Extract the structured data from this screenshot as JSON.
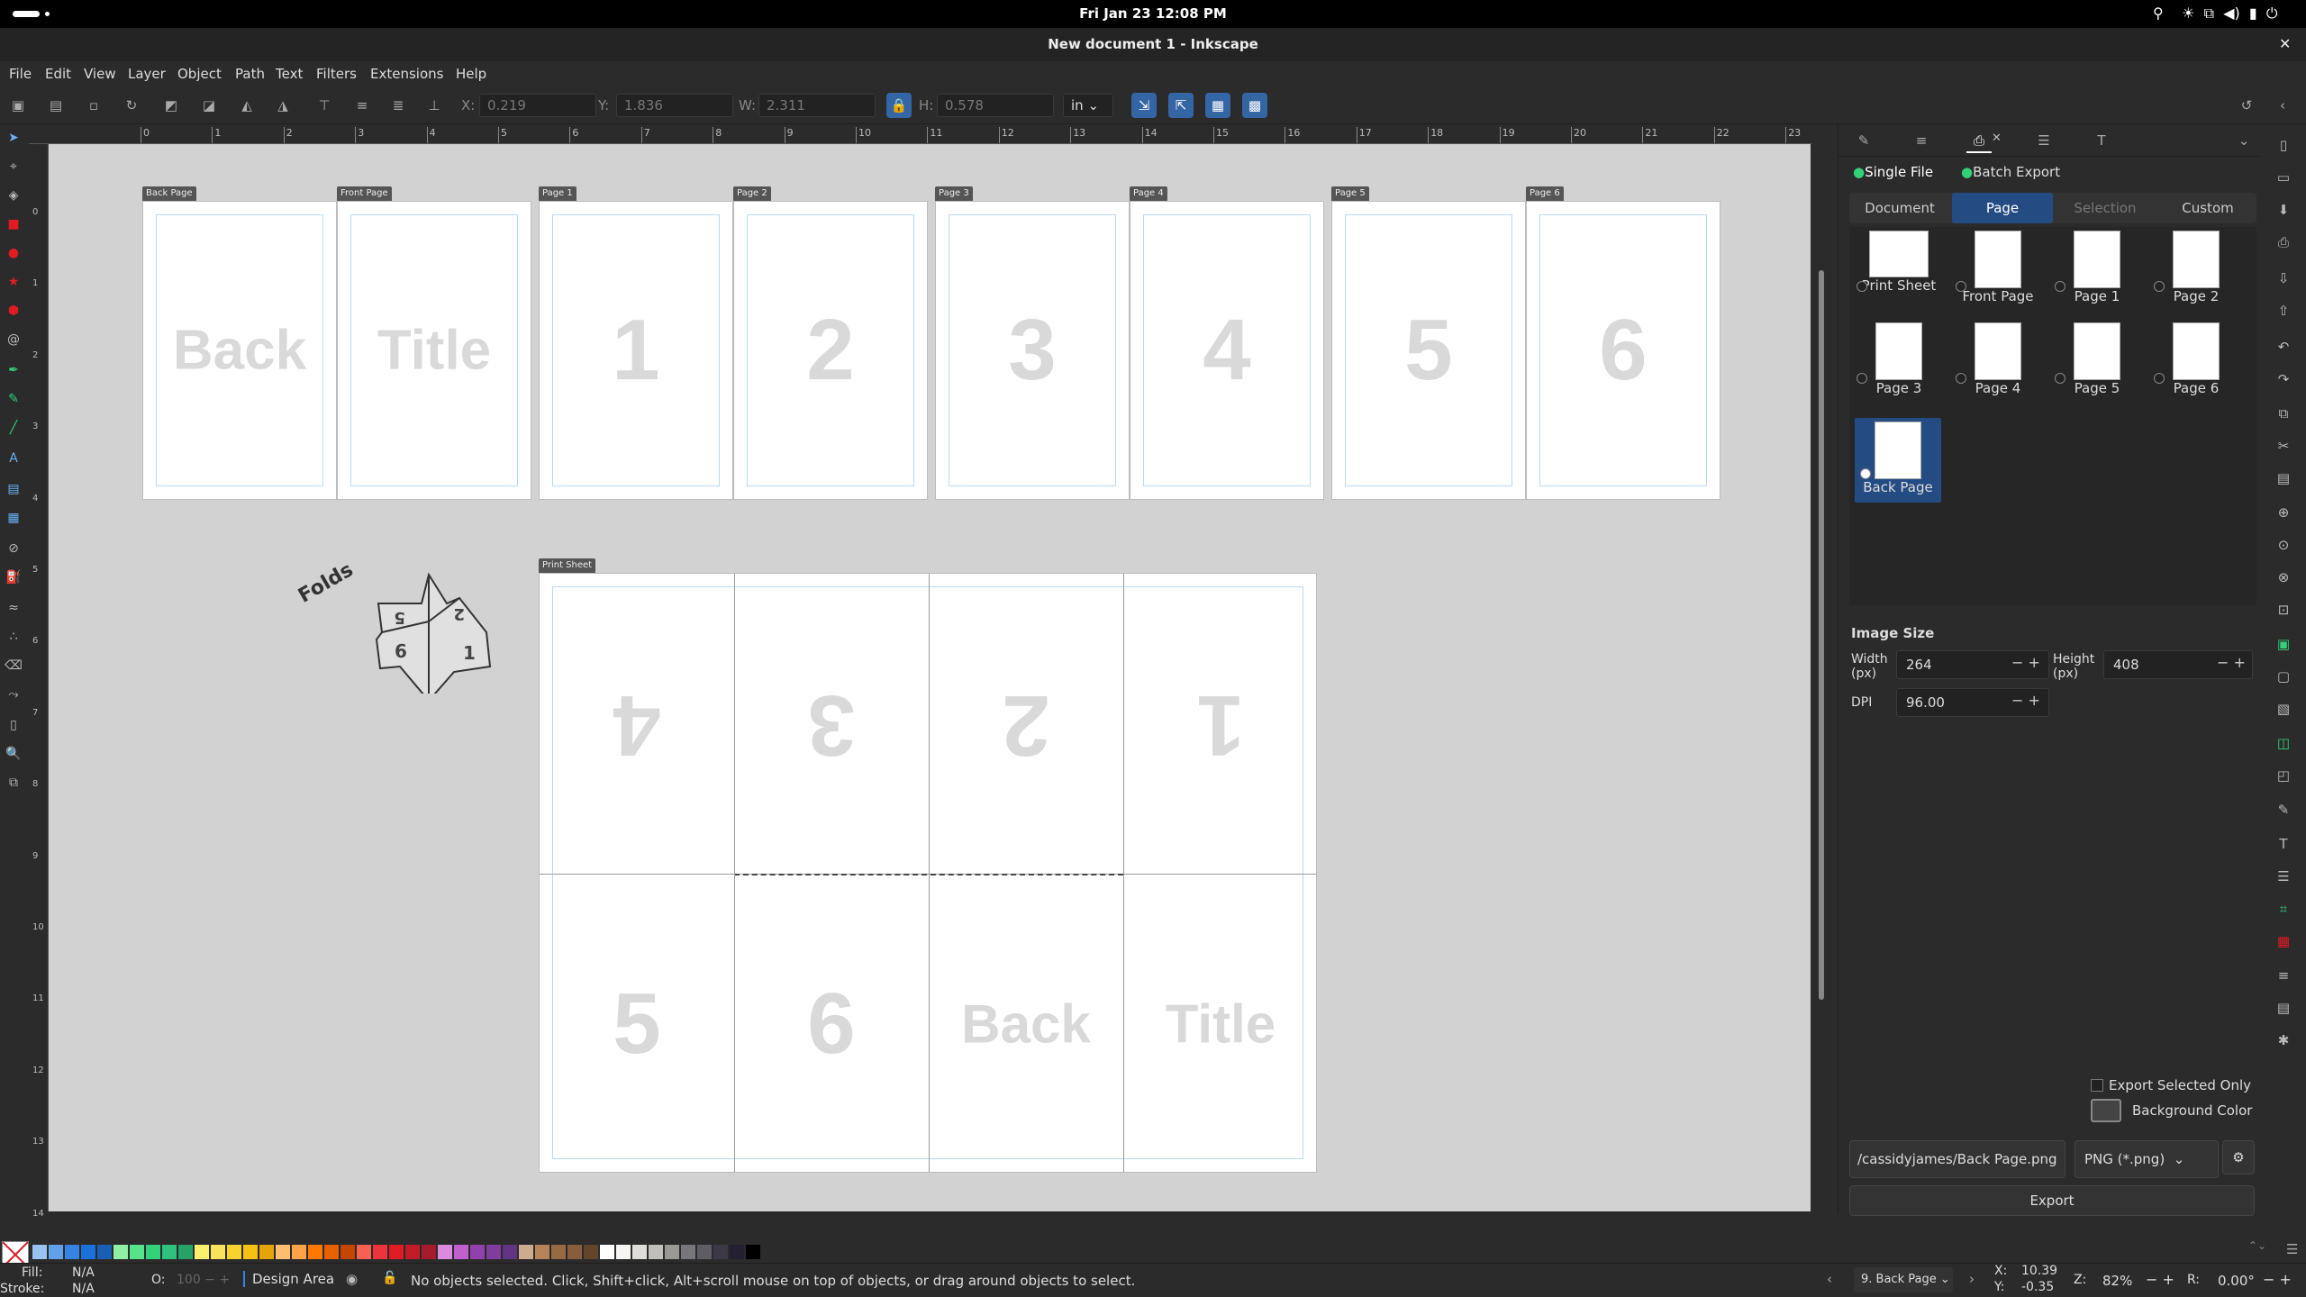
{
  "system_bar": {
    "datetime": "Fri Jan 23  12:08 PM"
  },
  "window": {
    "title": "New document 1 - Inkscape",
    "close_glyph": "✕"
  },
  "menu": [
    "File",
    "Edit",
    "View",
    "Layer",
    "Object",
    "Path",
    "Text",
    "Filters",
    "Extensions",
    "Help"
  ],
  "tool_controls": {
    "x_label": "X:",
    "x_value": "0.219",
    "y_label": "Y:",
    "y_value": "1.836",
    "w_label": "W:",
    "w_value": "2.311",
    "h_label": "H:",
    "h_value": "0.578",
    "unit": "in"
  },
  "ruler_top_labels": [
    "0",
    "1",
    "2",
    "3",
    "4",
    "5",
    "6",
    "7",
    "8",
    "9",
    "10",
    "11",
    "12",
    "13",
    "14",
    "15",
    "16",
    "17",
    "18",
    "19",
    "20",
    "21",
    "22",
    "23"
  ],
  "ruler_left_labels": [
    "0",
    "1",
    "2",
    "3",
    "4",
    "5",
    "6",
    "7",
    "8",
    "9",
    "10",
    "11",
    "12",
    "13",
    "14"
  ],
  "pages": [
    {
      "label": "Back Page",
      "text": "Back"
    },
    {
      "label": "Front Page",
      "text": "Title"
    },
    {
      "label": "Page 1",
      "text": "1"
    },
    {
      "label": "Page 2",
      "text": "2"
    },
    {
      "label": "Page 3",
      "text": "3"
    },
    {
      "label": "Page 4",
      "text": "4"
    },
    {
      "label": "Page 5",
      "text": "5"
    },
    {
      "label": "Page 6",
      "text": "6"
    }
  ],
  "print_sheet": {
    "label": "Print Sheet",
    "top_row": [
      "4",
      "3",
      "2",
      "1"
    ],
    "bottom_row": [
      "5",
      "6",
      "Back",
      "Title"
    ]
  },
  "folds_diagram": {
    "label": "Folds",
    "numbers": [
      "5",
      "2",
      "6",
      "1"
    ]
  },
  "export_panel": {
    "mode_tabs": [
      "Single File",
      "Batch Export"
    ],
    "area_tabs": [
      "Document",
      "Page",
      "Selection",
      "Custom"
    ],
    "active_area_tab": "Page",
    "thumbnails": [
      {
        "label": "Print Sheet",
        "selected": false
      },
      {
        "label": "Front Page",
        "selected": false
      },
      {
        "label": "Page 1",
        "selected": false
      },
      {
        "label": "Page 2",
        "selected": false
      },
      {
        "label": "Page 3",
        "selected": false
      },
      {
        "label": "Page 4",
        "selected": false
      },
      {
        "label": "Page 5",
        "selected": false
      },
      {
        "label": "Page 6",
        "selected": false
      },
      {
        "label": "Back Page",
        "selected": true
      }
    ],
    "image_size_heading": "Image Size",
    "width_label": "Width\n(px)",
    "width_value": "264",
    "height_label": "Height\n(px)",
    "height_value": "408",
    "dpi_label": "DPI",
    "dpi_value": "96.00",
    "export_selected_only": "Export Selected Only",
    "background_color": "Background Color",
    "filename": "/cassidyjames/Back Page.png",
    "format": "PNG (*.png)",
    "export_button": "Export"
  },
  "status": {
    "fill_label": "Fill:",
    "fill_value": "N/A",
    "stroke_label": "Stroke:",
    "stroke_value": "N/A",
    "opacity_label": "O:",
    "opacity_value": "100",
    "layer": "Design Area",
    "message": "No objects selected. Click, Shift+click, Alt+scroll mouse on top of objects, or drag around objects to select.",
    "page_select": "9. Back Page",
    "x_label": "X:",
    "x_value": "10.39",
    "y_label": "Y:",
    "y_value": "-0.35",
    "zoom_label": "Z:",
    "zoom_value": "82%",
    "rotate_label": "R:",
    "rotate_value": "0.00°"
  },
  "palette_colors": [
    "#99c1f1",
    "#62a0ea",
    "#3584e4",
    "#1c71d8",
    "#1a5fb4",
    "#8ff0a4",
    "#57e389",
    "#33d17a",
    "#2ec27e",
    "#26a269",
    "#f9f06b",
    "#f8e45c",
    "#f6d32d",
    "#f5c211",
    "#e5a50a",
    "#ffbe6f",
    "#ffa348",
    "#ff7800",
    "#e66100",
    "#c64600",
    "#f66151",
    "#ed333b",
    "#e01b24",
    "#c01c28",
    "#a51d2d",
    "#dc8add",
    "#c061cb",
    "#9141ac",
    "#813d9c",
    "#613583",
    "#cdab8f",
    "#b5835a",
    "#986a44",
    "#865e3c",
    "#63452c",
    "#ffffff",
    "#f6f5f4",
    "#deddda",
    "#c0bfbc",
    "#9a9996",
    "#77767b",
    "#5e5c64",
    "#3d3846",
    "#241f31",
    "#000000"
  ]
}
